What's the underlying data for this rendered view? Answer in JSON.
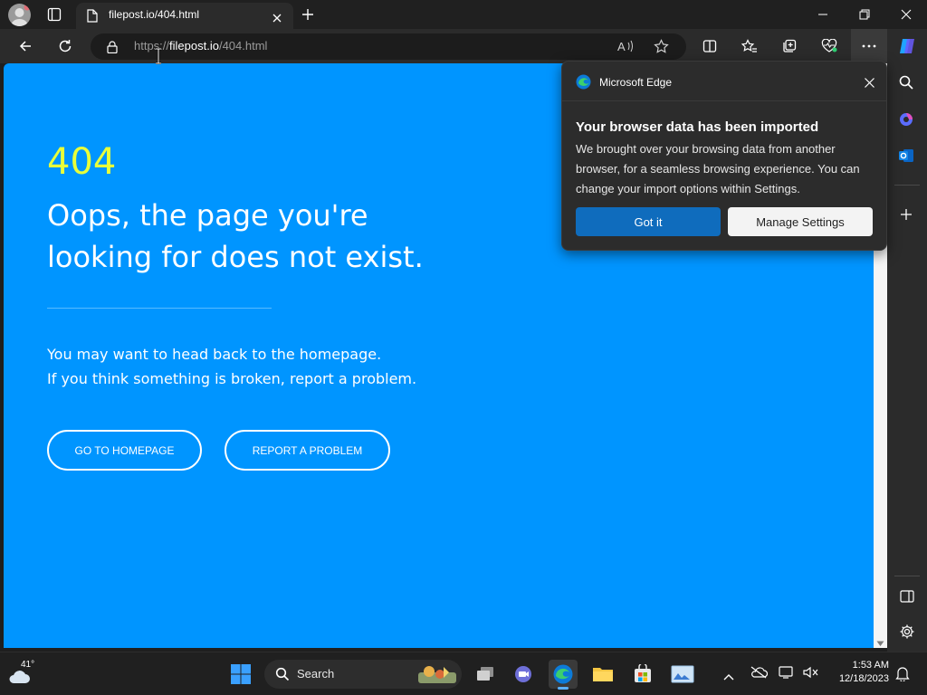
{
  "browser": {
    "tab": {
      "title": "filepost.io/404.html"
    },
    "address": {
      "scheme": "https://",
      "host": "filepost.io",
      "path": "/404.html"
    }
  },
  "page": {
    "code": "404",
    "title": "Oops, the page you're looking for does not exist.",
    "message_line1": "You may want to head back to the homepage.",
    "message_line2": "If you think something is broken, report a problem.",
    "btn_home": "GO TO HOMEPAGE",
    "btn_report": "REPORT A PROBLEM"
  },
  "popup": {
    "app": "Microsoft Edge",
    "title": "Your browser data has been imported",
    "body": "We brought over your browsing data from another browser, for a seamless browsing experience. You can change your import options within Settings.",
    "primary": "Got it",
    "secondary": "Manage Settings"
  },
  "taskbar": {
    "weather": "41°",
    "search": "Search",
    "time": "1:53 AM",
    "date": "12/18/2023"
  },
  "colors": {
    "page_bg": "#0095ff",
    "code": "#e8ff3a",
    "primary_btn": "#0f6cbd"
  }
}
